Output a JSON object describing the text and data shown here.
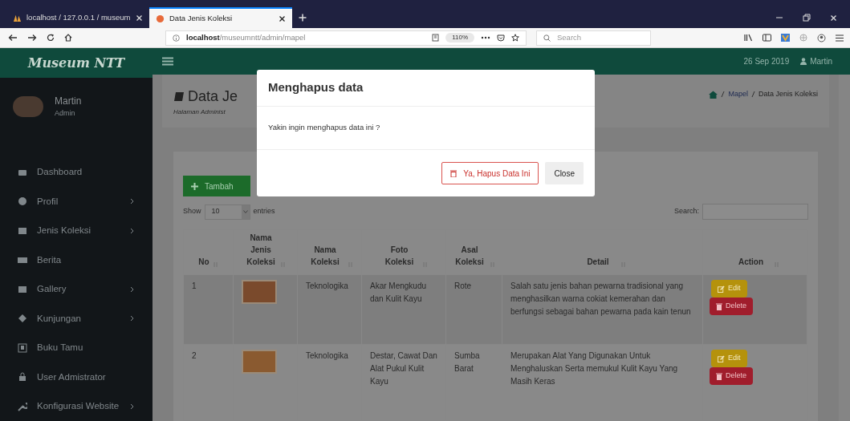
{
  "browser": {
    "tabs": [
      {
        "title": "localhost / 127.0.0.1 / museum",
        "selected": false
      },
      {
        "title": "Data Jenis Koleksi",
        "selected": true
      }
    ],
    "url": "**localhost**/museumntt/admin/mapel",
    "zoom": "110%",
    "search_placeholder": "Search"
  },
  "header": {
    "brand": "Museum NTT",
    "date": "26 Sep 2019",
    "user": "Martin"
  },
  "sidebar": {
    "user": {
      "name": "Martin",
      "role": "Admin"
    },
    "items": [
      {
        "label": "Dashboard",
        "has_submenu": false
      },
      {
        "label": "Profil",
        "has_submenu": true
      },
      {
        "label": "Jenis Koleksi",
        "has_submenu": true
      },
      {
        "label": "Berita",
        "has_submenu": false
      },
      {
        "label": "Gallery",
        "has_submenu": true
      },
      {
        "label": "Kunjungan",
        "has_submenu": true
      },
      {
        "label": "Buku Tamu",
        "has_submenu": false
      },
      {
        "label": "User Admistrator",
        "has_submenu": false
      },
      {
        "label": "Konfigurasi Website",
        "has_submenu": true
      }
    ]
  },
  "page": {
    "title": "Data Je",
    "subtitle": "Halaman Administ",
    "breadcrumb": [
      "Mapel",
      "Data Jenis Koleksi"
    ]
  },
  "toolbar": {
    "add_button": "Tambah",
    "show": "Show",
    "entries_value": "10",
    "entries": "entries",
    "search_label": "Search:"
  },
  "table": {
    "columns": [
      "No",
      "Nama Jenis Koleksi",
      "Nama Koleksi",
      "Foto Koleksi",
      "Asal Koleksi",
      "Detail",
      "Action"
    ],
    "rows": [
      {
        "no": "1",
        "nama_koleksi": "Teknologika",
        "foto_koleksi": "Akar Mengkudu dan Kulit Kayu",
        "asal_koleksi": "Rote",
        "detail": "Salah satu jenis bahan pewarna tradisional yang menghasilkan warna cokiat kemerahan dan berfungsi sebagai bahan pewarna pada kain tenun",
        "actions": [
          "Edit",
          "Delete"
        ]
      },
      {
        "no": "2",
        "nama_koleksi": "Teknologika",
        "foto_koleksi": "Destar, Cawat Dan Alat Pukul Kulit Kayu",
        "asal_koleksi": "Sumba Barat",
        "detail": "Merupakan Alat Yang Digunakan Untuk Menghaluskan Serta memukul Kulit Kayu Yang Masih Keras",
        "actions": [
          "Edit",
          "Delete"
        ]
      }
    ]
  },
  "modal": {
    "title": "Menghapus data",
    "message": "Yakin ingin menghapus data ini ?",
    "confirm": "Ya, Hapus Data Ini",
    "close": "Close"
  }
}
